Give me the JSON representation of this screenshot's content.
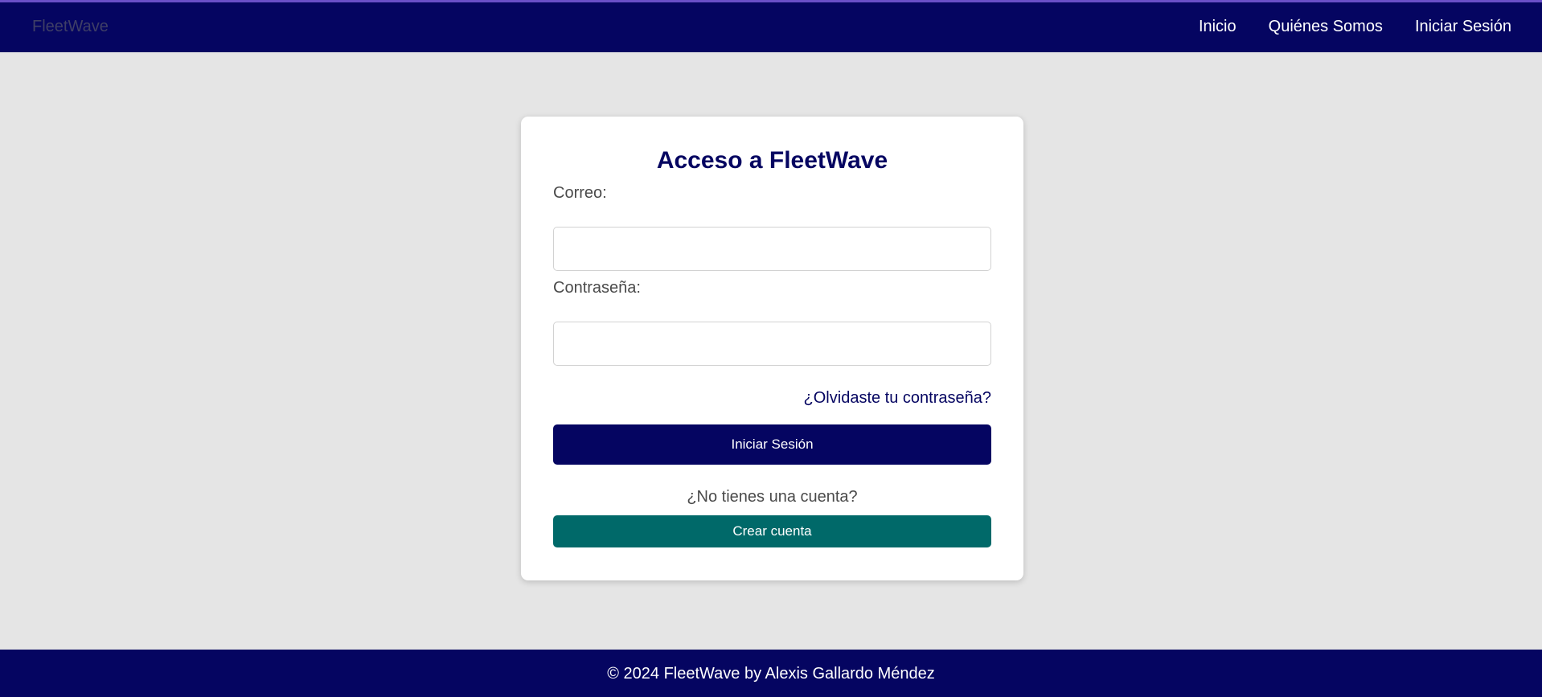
{
  "header": {
    "brand": "FleetWave",
    "nav": [
      {
        "label": "Inicio"
      },
      {
        "label": "Quiénes Somos"
      },
      {
        "label": "Iniciar Sesión"
      }
    ]
  },
  "login": {
    "title": "Acceso a FleetWave",
    "email_label": "Correo:",
    "email_value": "",
    "password_label": "Contraseña:",
    "password_value": "",
    "forgot_link": "¿Olvidaste tu contraseña?",
    "submit_button": "Iniciar Sesión",
    "no_account_text": "¿No tienes una cuenta?",
    "create_account_button": "Crear cuenta"
  },
  "footer": {
    "text": "© 2024 FleetWave by Alexis Gallardo Méndez"
  },
  "colors": {
    "primary": "#050561",
    "secondary": "#006969",
    "background": "#e5e5e5"
  }
}
